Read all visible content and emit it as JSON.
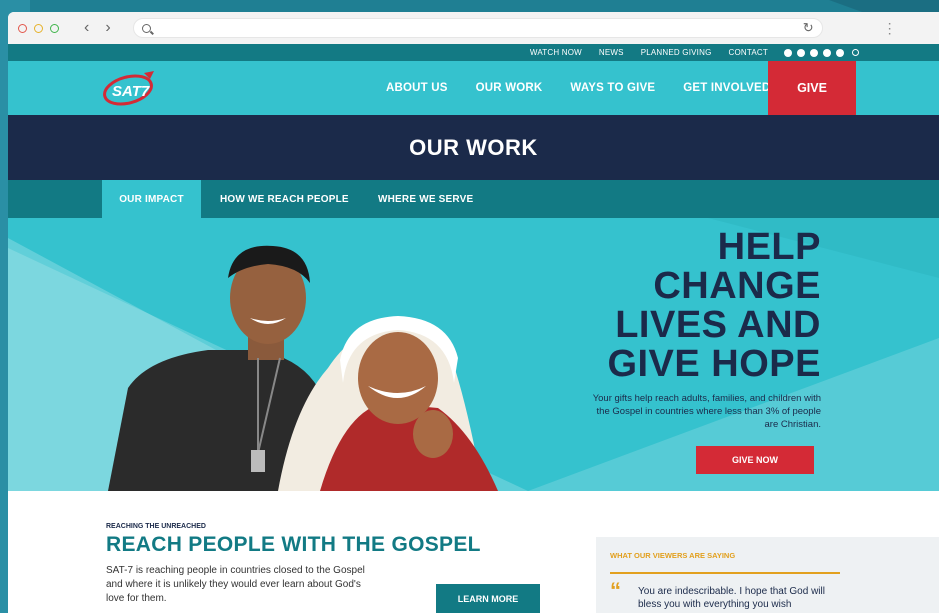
{
  "browser": {
    "address_value": "",
    "back_label": "‹",
    "forward_label": "›",
    "reload_label": "↻",
    "menu_label": "⋮"
  },
  "utility_nav": {
    "links": [
      "WATCH NOW",
      "NEWS",
      "PLANNED GIVING",
      "CONTACT"
    ],
    "social_icons": [
      "facebook-icon",
      "twitter-icon",
      "youtube-icon",
      "instagram-icon",
      "pinterest-icon"
    ]
  },
  "main_nav": {
    "logo_text": "SAT7",
    "items": [
      "ABOUT US",
      "OUR WORK",
      "WAYS TO GIVE",
      "GET INVOLVED"
    ],
    "give_label": "GIVE"
  },
  "page_title": "OUR WORK",
  "sub_nav": {
    "tabs": [
      "OUR IMPACT",
      "HOW WE REACH PEOPLE",
      "WHERE WE SERVE"
    ],
    "active_index": 0
  },
  "hero": {
    "headline_lines": [
      "HELP",
      "CHANGE",
      "LIVES AND",
      "GIVE HOPE"
    ],
    "body": "Your gifts help reach adults, families, and children with the Gospel in countries where less than 3% of people are Christian.",
    "cta_label": "GIVE NOW"
  },
  "gospel_section": {
    "eyebrow": "REACHING THE UNREACHED",
    "heading": "REACH PEOPLE WITH THE GOSPEL",
    "body": "SAT-7 is reaching people in countries closed to the Gospel and where it is unlikely they would ever learn about God's love for them.",
    "cta_label": "LEARN MORE"
  },
  "testimonial": {
    "heading": "WHAT OUR VIEWERS ARE SAYING",
    "quote_mark": "“",
    "quote": "You are indescribable. I hope that God will bless you with everything you wish"
  },
  "colors": {
    "teal": "#35c2ce",
    "dark_teal": "#127a84",
    "navy": "#1b2a4a",
    "red": "#d42a36",
    "gold": "#e2a01e"
  }
}
